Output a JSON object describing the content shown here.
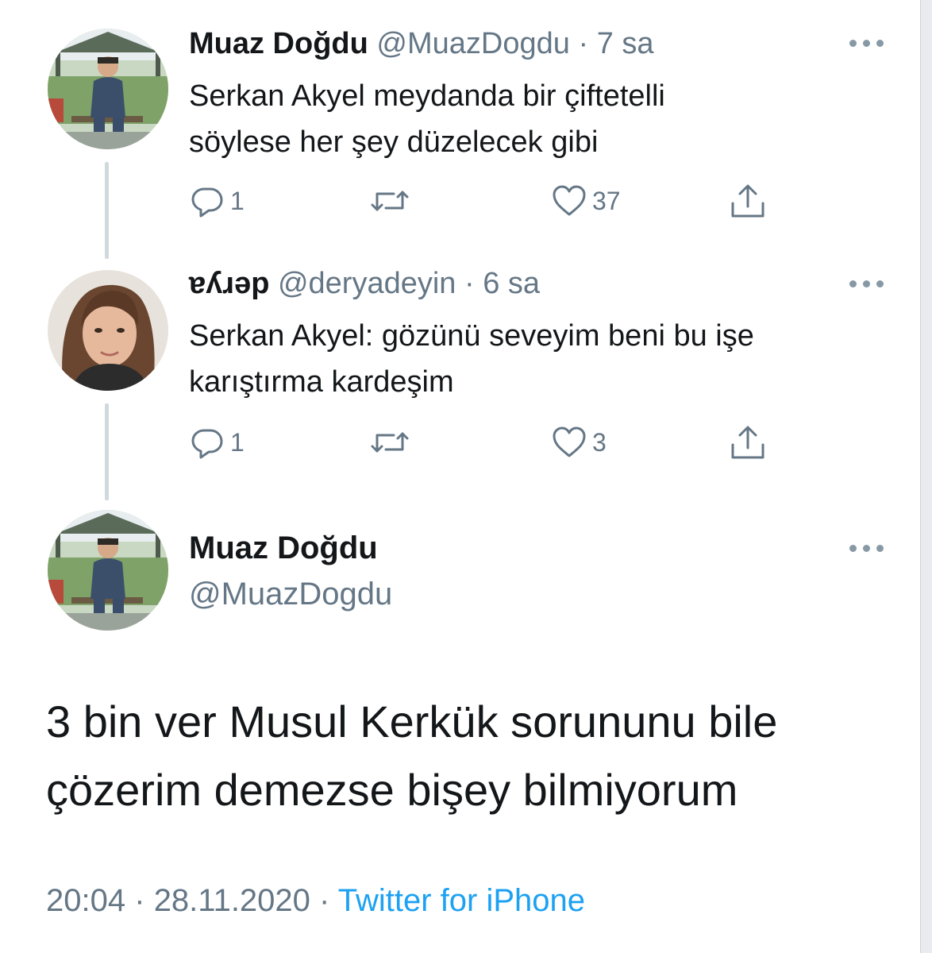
{
  "tweet1": {
    "name": "Muaz Doğdu",
    "handle": "@MuazDogdu",
    "time": "7 sa",
    "text_line1": "Serkan Akyel meydanda bir çiftetelli",
    "text_line2": "söylese her şey düzelecek gibi",
    "reply_count": "1",
    "like_count": "37"
  },
  "tweet2": {
    "name": "ɐʎɹǝp",
    "handle": "@deryadeyin",
    "time": "6 sa",
    "text_line1": "Serkan Akyel: gözünü seveyim beni bu işe",
    "text_line2": "karıştırma kardeşim",
    "reply_count": "1",
    "like_count": "3"
  },
  "main": {
    "name": "Muaz Doğdu",
    "handle": "@MuazDogdu",
    "text_line1": "3 bin ver Musul Kerkük sorununu bile",
    "text_line2": "çözerim demezse bişey bilmiyorum",
    "time": "20:04",
    "date": "28.11.2020",
    "source": "Twitter for iPhone"
  },
  "separator": "·",
  "icons": {
    "reply": "reply-icon",
    "retweet": "retweet-icon",
    "like": "heart-icon",
    "share": "share-icon",
    "more": "more-options-icon"
  },
  "colors": {
    "text": "#14171a",
    "secondary": "#657786",
    "link": "#1da1f2",
    "thread_line": "#cfd9de"
  }
}
